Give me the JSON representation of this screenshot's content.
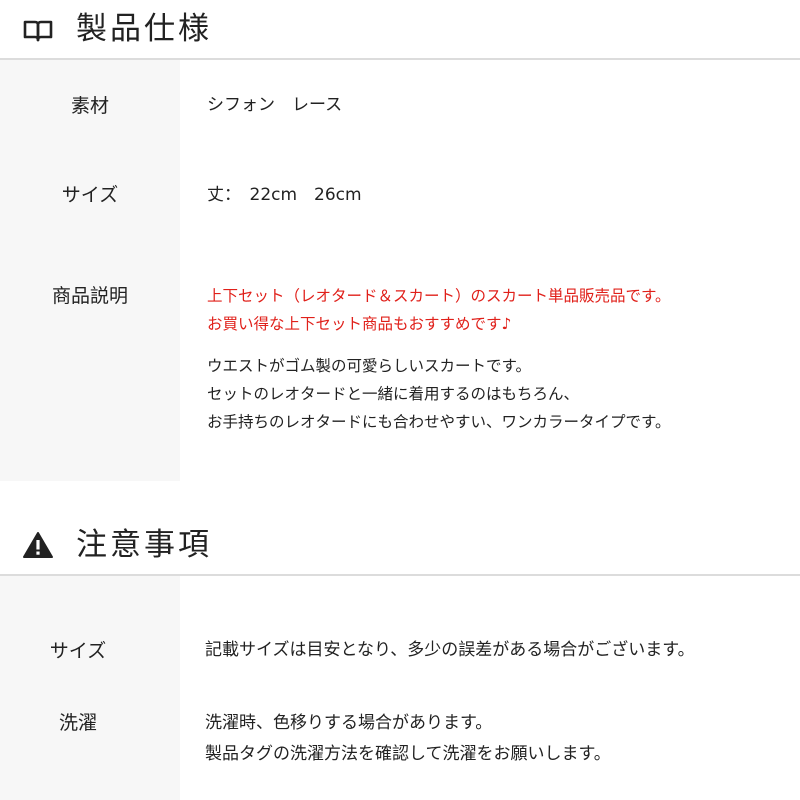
{
  "spec": {
    "title": "製品仕様",
    "rows": [
      {
        "label": "素材",
        "value": "シフォン　レース"
      },
      {
        "label": "サイズ",
        "value": "丈：　22cm　26cm"
      },
      {
        "label": "商品説明",
        "highlight": [
          "上下セット（レオタード＆スカート）のスカート単品販売品です。",
          "お買い得な上下セット商品もおすすめです♪"
        ],
        "body": [
          "ウエストがゴム製の可愛らしいスカートです。",
          "セットのレオタードと一緒に着用するのはもちろん、",
          "お手持ちのレオタードにも合わせやすい、ワンカラータイプです。"
        ]
      }
    ]
  },
  "notes": {
    "title": "注意事項",
    "rows": [
      {
        "label": "サイズ",
        "lines": [
          "記載サイズは目安となり、多少の誤差がある場合がございます。"
        ]
      },
      {
        "label": "洗濯",
        "lines": [
          "洗濯時、色移りする場合があります。",
          "製品タグの洗濯方法を確認して洗濯をお願いします。"
        ]
      }
    ]
  },
  "colors": {
    "highlight": "#e0201a",
    "label_bg": "#f7f7f7",
    "divider": "#dcdcdc"
  }
}
